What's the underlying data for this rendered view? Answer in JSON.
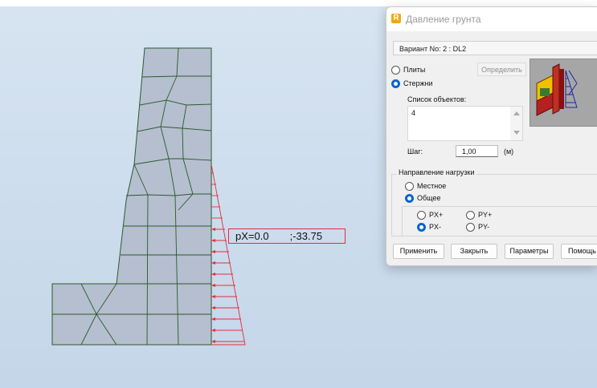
{
  "canvas": {
    "tooltip": {
      "px_text": "pX=0.0",
      "value_text": ";-33.75"
    }
  },
  "dialog": {
    "title": "Давление грунта",
    "app_icon_letter": "R",
    "variant_text": "Вариант No: 2 : DL2",
    "plates_label": "Плиты",
    "define_label": "Определить",
    "rods_label": "Стержни",
    "objects_list_label": "Список объектов:",
    "objects_list_value": "4",
    "step_label": "Шаг:",
    "step_value": "1,00",
    "step_unit": "(м)",
    "load_direction_title": "Направление нагрузки",
    "local_label": "Местное",
    "global_label": "Общее",
    "px_plus_label": "PX+",
    "py_plus_label": "PY+",
    "px_minus_label": "PX-",
    "py_minus_label": "PY-",
    "apply_label": "Применить",
    "close_label": "Закрыть",
    "params_label": "Параметры",
    "help_label": "Помощь"
  },
  "colors": {
    "mesh_fill": "#b5bfcf",
    "mesh_edge": "#2d5a2d",
    "load_color": "#e0303a",
    "radio_selected": "#0a64c8"
  }
}
